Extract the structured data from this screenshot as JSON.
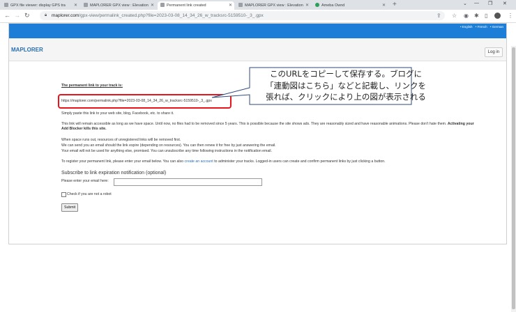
{
  "tabs": [
    {
      "label": "GPX file viewer: display GPS tra"
    },
    {
      "label": "MAPLORER GPX view : Elevation"
    },
    {
      "label": "Permanent link created"
    },
    {
      "label": "MAPLORER GPX view : Elevation"
    },
    {
      "label": "Ameba Ownd"
    }
  ],
  "address": {
    "host": "maplorer.com",
    "path": "/gpx-view/permalink_created.php?file=2023-03-08_14_34_26_w_tracksrc-5159510-_3_.gpx"
  },
  "site": {
    "languages": [
      "• English",
      "• French",
      "• German"
    ],
    "brand": "MAPLORER",
    "login_label": "Log in"
  },
  "content": {
    "perma_title": "The permanent link to your track is:",
    "perma_link": "https://maplorer.com/permalink.php?file=2023-03-08_14_34_26_w_tracksrc-5159510-_3_.gpx",
    "simply_paste": "Simply paste this link to your web site, blog, Facebook, etc. to share it.",
    "retention_1": "This link will remain accessible as long as we have space. Until now, no files had to be removed since 5 years. This is possible because the site shows ads. They are reasonably sized and have reasonable animations. Please don't hate them.",
    "retention_bold": "Activating your",
    "retention_2": "Add Blocker kills this site.",
    "space_1": "When space runs out, resources of unregistered links will be removed first.",
    "space_2": "We can send you an email should the link expire (depending on resources). You can then renew it for free by just answering the email.",
    "space_3": "Your email will not be used for anything else, promised. You can unsubscribe any time following instructions in the notification email.",
    "register_pre": "To register your permanent link, please enter your email below. You can also",
    "register_link": "create an account",
    "register_post": "to administer your tracks. Logged-in users can create and confirm permanent links by just clicking a button.",
    "subscribe_title": "Subscribe to link expiration notification (optional)",
    "email_label": "Please enter your email here:",
    "email_value": "",
    "robot_label": "Check if you are not a robot",
    "submit_label": "Submit"
  },
  "annotation": {
    "lines": [
      "このURLをコピーして保存する。ブログに",
      "「連動図はこちら」などと記載し、リンクを",
      "張れば、クリックにより上の図が表示される"
    ],
    "highlight_color": "#e8141c"
  },
  "icons": [
    "back-arrow-icon",
    "forward-arrow-icon",
    "reload-icon",
    "lock-icon",
    "share-icon",
    "star-icon",
    "extensions-icon",
    "sidebar-icon",
    "avatar",
    "menu-dots-icon"
  ]
}
